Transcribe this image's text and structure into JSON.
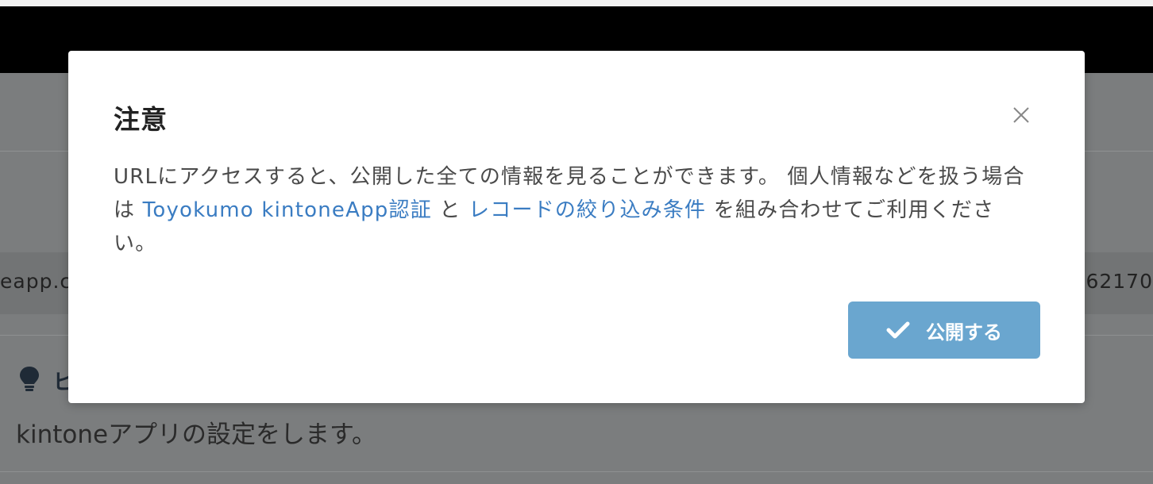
{
  "background": {
    "url_left": "eapp.c",
    "url_right": "62170",
    "hint_title": "ヒ",
    "hint_text": "kintoneアプリの設定をします。"
  },
  "modal": {
    "title": "注意",
    "body_part1": "URLにアクセスすると、公開した全ての情報を見ることができます。 個人情報などを扱う場合は",
    "link1": "Toyokumo kintoneApp認証",
    "body_part2": "と",
    "link2": "レコードの絞り込み条件",
    "body_part3": "を組み合わせてご利用ください。",
    "publish_label": "公開する",
    "colors": {
      "link": "#3a7cc2",
      "button": "#6aa6cf"
    }
  }
}
